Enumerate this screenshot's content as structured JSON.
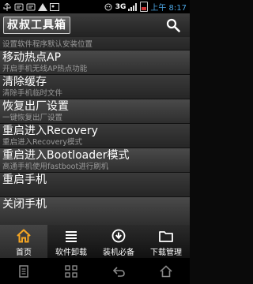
{
  "status_bar": {
    "network": "3G",
    "time": "上午 8:17"
  },
  "header": {
    "title": "叔叔工具箱"
  },
  "menu": {
    "items": [
      {
        "title": "",
        "subtitle": "设置软件程序默认安装位置"
      },
      {
        "title": "移动热点AP",
        "subtitle": "开启手机无线AP热点功能"
      },
      {
        "title": "清除缓存",
        "subtitle": "清除手机临时文件"
      },
      {
        "title": "恢复出厂设置",
        "subtitle": "一键恢复出厂设置"
      },
      {
        "title": "重启进入Recovery",
        "subtitle": "重启进入Recovery模式"
      },
      {
        "title": "重启进入Bootloader模式",
        "subtitle": "高通手机使用fastboot进行刷机"
      },
      {
        "title": "重启手机",
        "subtitle": ""
      },
      {
        "title": "关闭手机",
        "subtitle": ""
      }
    ]
  },
  "tabs": [
    {
      "label": "首页",
      "icon": "home-icon",
      "active": true
    },
    {
      "label": "软件卸载",
      "icon": "list-icon",
      "active": false
    },
    {
      "label": "装机必备",
      "icon": "download-circle-icon",
      "active": false
    },
    {
      "label": "下载管理",
      "icon": "folder-icon",
      "active": false
    }
  ],
  "colors": {
    "time": "#4aa3e0",
    "subtitle": "#9a9a9a",
    "background": "#0a0a0a"
  }
}
